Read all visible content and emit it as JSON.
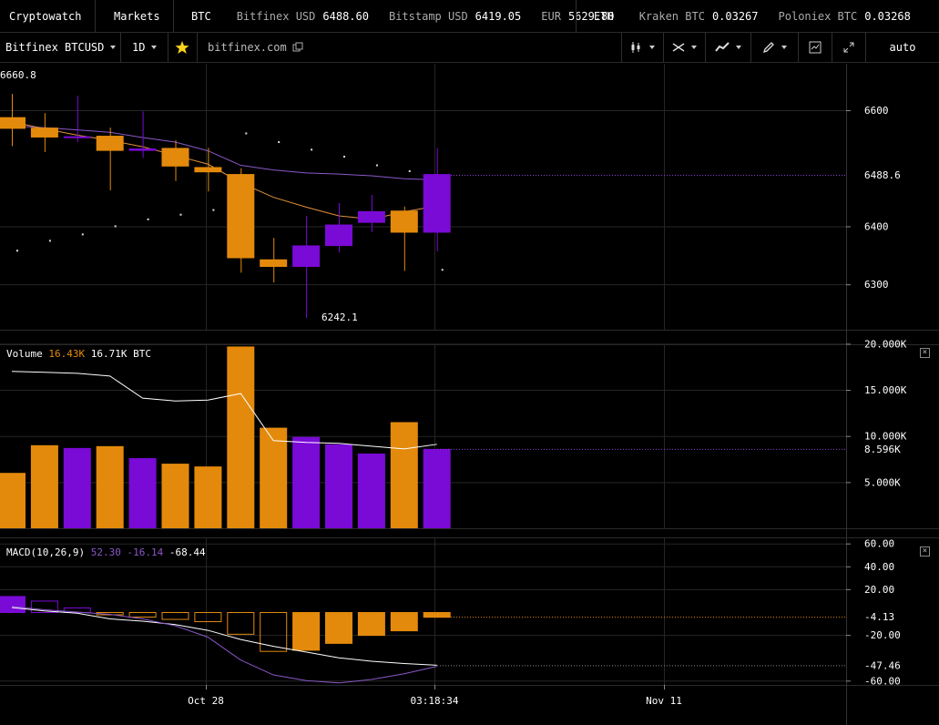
{
  "topbar": {
    "brand": "Cryptowatch",
    "markets_label": "Markets",
    "groups": [
      {
        "base": "BTC",
        "tickers": [
          {
            "name": "Bitfinex USD",
            "value": "6488.60"
          },
          {
            "name": "Bitstamp USD",
            "value": "6419.05"
          },
          {
            "name": "EUR",
            "value": "5629.80"
          }
        ]
      },
      {
        "base": "ETH",
        "tickers": [
          {
            "name": "Kraken BTC",
            "value": "0.03267"
          },
          {
            "name": "Poloniex BTC",
            "value": "0.03268"
          }
        ]
      }
    ]
  },
  "toolbar": {
    "market": "Bitfinex BTCUSD",
    "interval": "1D",
    "exchange_link": "bitfinex.com",
    "scale": "auto"
  },
  "colors": {
    "up": "#7a0ad6",
    "down": "#e38a0c",
    "grid": "#262626",
    "sma_long": "#8a58c8",
    "sma_short": "#e0903c"
  },
  "price_panel": {
    "top_label": "6660.8",
    "low_label": "6242.1",
    "current_label": "6488.6",
    "current": 6488.6,
    "ticks": [
      "6600",
      "6400",
      "6300"
    ],
    "tick_values": [
      6600,
      6400,
      6300
    ]
  },
  "volume_panel": {
    "label": "Volume",
    "value_a": "16.43K",
    "value_b": "16.71K",
    "unit": "BTC",
    "current_label": "8.596K",
    "current": 8.596,
    "ticks": [
      "20.000K",
      "15.000K",
      "10.000K",
      "5.000K"
    ],
    "tick_values": [
      20,
      15,
      10,
      5
    ]
  },
  "macd_panel": {
    "label": "MACD(10,26,9)",
    "value_a": "52.30",
    "value_b": "-16.14",
    "value_c": "-68.44",
    "current_hist_label": "-4.13",
    "current_line_label": "-47.46",
    "ticks": [
      "60.00",
      "40.00",
      "20.00",
      "-20.00",
      "-60.00"
    ],
    "tick_values": [
      60,
      40,
      20,
      -20,
      -60
    ]
  },
  "time_axis": {
    "labels": [
      "Oct 28",
      "03:18:34",
      "Nov 11"
    ]
  },
  "chart_data": {
    "type": "candlestick",
    "candles": [
      {
        "o": 6588,
        "h": 6628,
        "l": 6538,
        "c": 6568,
        "v": 6.0
      },
      {
        "o": 6570,
        "h": 6595,
        "l": 6528,
        "c": 6553,
        "v": 9.0
      },
      {
        "o": 6553,
        "h": 6625,
        "l": 6545,
        "c": 6555,
        "v": 8.7
      },
      {
        "o": 6556,
        "h": 6570,
        "l": 6462,
        "c": 6530,
        "v": 8.9
      },
      {
        "o": 6530,
        "h": 6598,
        "l": 6518,
        "c": 6534,
        "v": 7.6
      },
      {
        "o": 6535,
        "h": 6548,
        "l": 6478,
        "c": 6503,
        "v": 7.0
      },
      {
        "o": 6502,
        "h": 6535,
        "l": 6460,
        "c": 6493,
        "v": 6.7
      },
      {
        "o": 6490,
        "h": 6500,
        "l": 6320,
        "c": 6345,
        "v": 19.7
      },
      {
        "o": 6343,
        "h": 6380,
        "l": 6303,
        "c": 6330,
        "v": 10.9
      },
      {
        "o": 6330,
        "h": 6418,
        "l": 6242,
        "c": 6367,
        "v": 9.9
      },
      {
        "o": 6366,
        "h": 6440,
        "l": 6355,
        "c": 6403,
        "v": 9.1
      },
      {
        "o": 6406,
        "h": 6454,
        "l": 6390,
        "c": 6426,
        "v": 8.1
      },
      {
        "o": 6427,
        "h": 6434,
        "l": 6323,
        "c": 6389,
        "v": 11.5
      },
      {
        "o": 6389,
        "h": 6535,
        "l": 6357,
        "c": 6490,
        "v": 8.6
      }
    ],
    "sma_long": [
      6573,
      6570,
      6566,
      6562,
      6553,
      6545,
      6530,
      6505,
      6497,
      6492,
      6490,
      6487,
      6482,
      6480
    ],
    "sma_short": [
      6580,
      6568,
      6557,
      6548,
      6537,
      6522,
      6507,
      6475,
      6450,
      6433,
      6418,
      6412,
      6425,
      6435
    ],
    "psar": [
      6358,
      6375,
      6386,
      6400,
      6412,
      6420,
      6428,
      6560,
      6545,
      6532,
      6520,
      6505,
      6495,
      6325
    ],
    "volume_sma": [
      17.0,
      16.9,
      16.8,
      16.5,
      14.1,
      13.8,
      13.9,
      14.6,
      9.5,
      9.3,
      9.2,
      8.9,
      8.6,
      9.1
    ],
    "macd_hist": [
      14,
      10,
      4,
      -2,
      -4,
      -6,
      -8,
      -19,
      -34,
      -33,
      -27,
      -20,
      -16,
      -4.13
    ],
    "macd_line": [
      5,
      2,
      0,
      -2,
      -6,
      -12,
      -22,
      -42,
      -55,
      -60,
      -62,
      -59,
      -54,
      -47.5
    ],
    "signal_line": [
      4,
      1,
      -1,
      -6,
      -8,
      -11,
      -16,
      -24,
      -30,
      -35,
      -40,
      -43,
      -45,
      -46.5
    ],
    "xlabel": "",
    "ylabel": ""
  }
}
